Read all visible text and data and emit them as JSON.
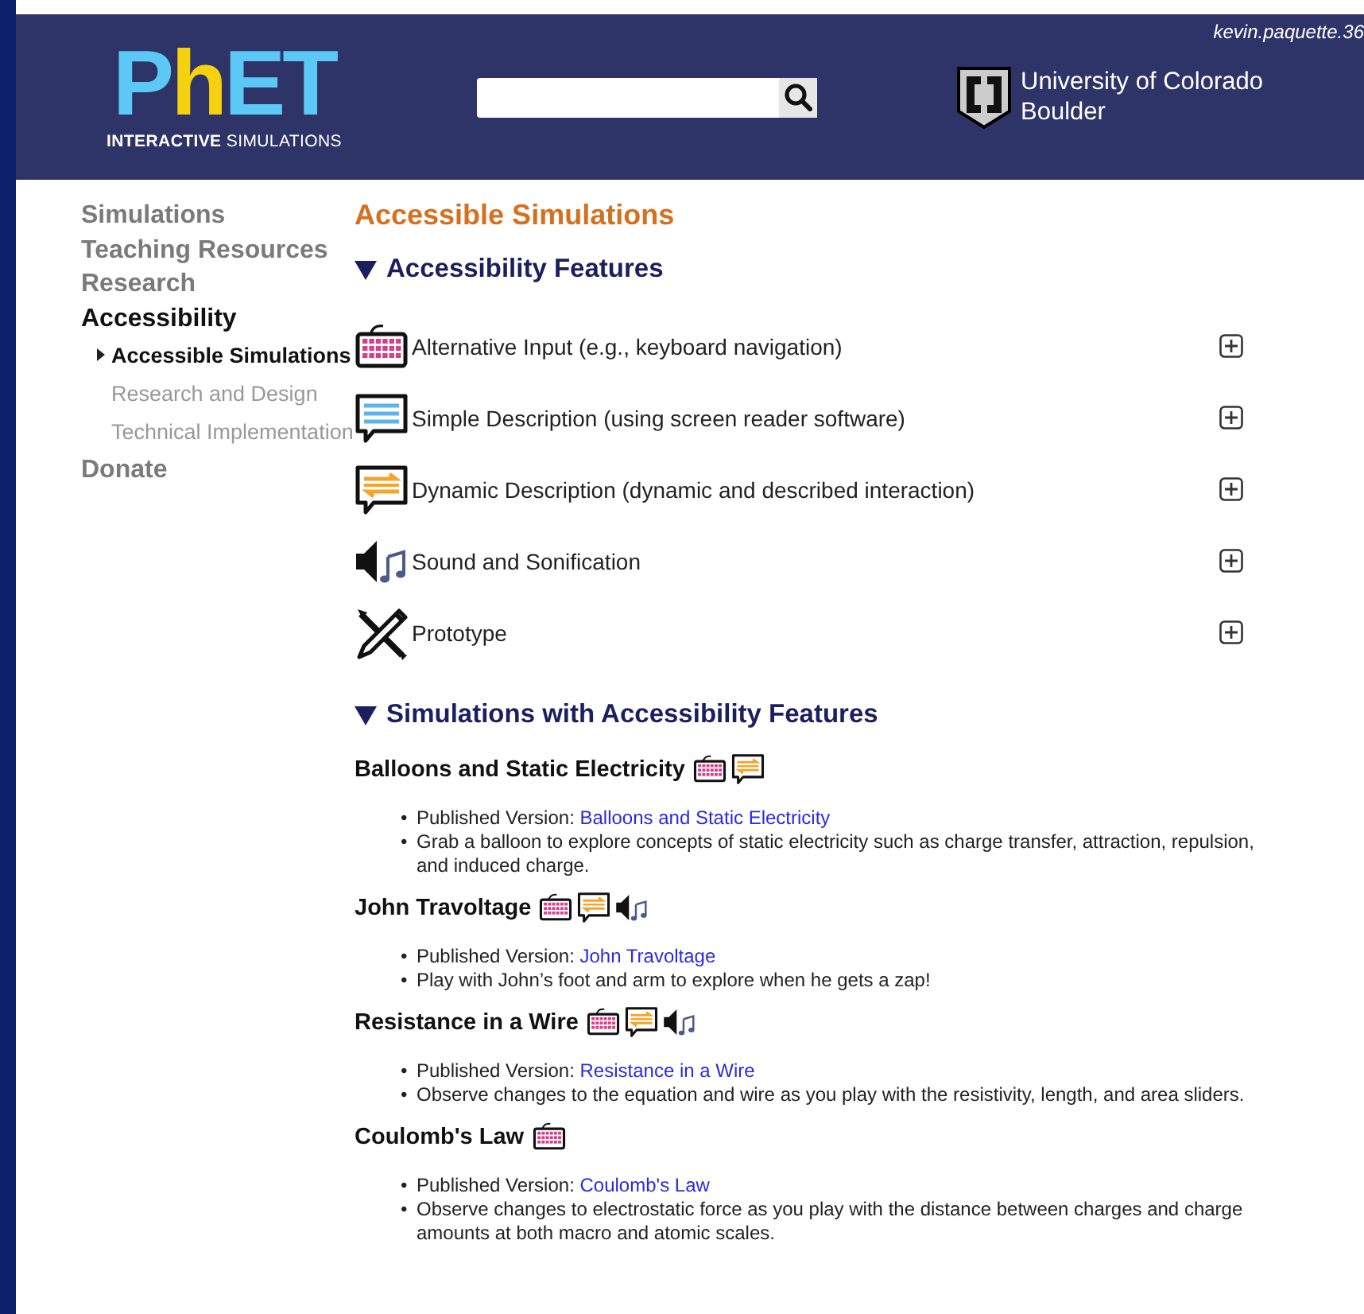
{
  "header": {
    "logo": {
      "letters": [
        {
          "text": "P",
          "accent": false
        },
        {
          "text": "h",
          "accent": true
        },
        {
          "text": "ET",
          "accent": false
        }
      ],
      "tagline": "**INTERACTIVE** SIMULATIONS"
    },
    "university": [
      "University of Colorado",
      "Boulder"
    ],
    "user": "kevin.paquette.36"
  },
  "sidebar": {
    "items": [
      {
        "label": "Simulations",
        "selected": false
      },
      {
        "label": "Teaching Resources",
        "selected": false
      },
      {
        "label": "Research",
        "selected": false
      },
      {
        "label": "Accessibility",
        "selected": true,
        "children": [
          {
            "label": "Accessible Simulations",
            "selected": true
          },
          {
            "label": "Research and Design",
            "selected": false
          },
          {
            "label": "Technical Implementation",
            "selected": false
          }
        ]
      },
      {
        "label": "Donate",
        "selected": false
      }
    ]
  },
  "page_title": "Accessible Simulations",
  "features_section": {
    "title": "Accessibility Features",
    "expanded": true,
    "items": [
      {
        "kind": "keyboard",
        "label": "Alternative Input (e.g., keyboard navigation)",
        "expanded": false
      },
      {
        "kind": "simple",
        "label": "Simple Description (using screen reader software)",
        "expanded": false
      },
      {
        "kind": "dynamic",
        "label": "Dynamic Description (dynamic and described interaction)",
        "expanded": false
      },
      {
        "kind": "sound",
        "label": "Sound and Sonification",
        "expanded": false
      },
      {
        "kind": "prototype",
        "label": "Prototype",
        "expanded": false
      }
    ]
  },
  "sims_section": {
    "title": "Simulations with Accessibility Features",
    "expanded": true,
    "items": [
      {
        "title": "Balloons and Static Electricity",
        "features": [
          {
            "kind": "keyboard"
          },
          {
            "kind": "dynamic"
          }
        ],
        "lines": [
          {
            "kind": "link",
            "marker": "•",
            "label": "Published Version:",
            "link": "Balloons and Static Electricity"
          },
          {
            "kind": "text",
            "marker": "•",
            "text": "Grab a balloon to explore concepts of static electricity such as charge transfer, attraction, repulsion, and induced charge."
          }
        ]
      },
      {
        "title": "John Travoltage",
        "features": [
          {
            "kind": "keyboard"
          },
          {
            "kind": "dynamic"
          },
          {
            "kind": "sound"
          }
        ],
        "lines": [
          {
            "kind": "link",
            "marker": "•",
            "label": "Published Version:",
            "link": "John Travoltage"
          },
          {
            "kind": "text",
            "marker": "•",
            "text": "Play with John’s foot and arm to explore when he gets a zap!"
          }
        ]
      },
      {
        "title": "Resistance in a Wire",
        "features": [
          {
            "kind": "keyboard"
          },
          {
            "kind": "dynamic"
          },
          {
            "kind": "sound"
          }
        ],
        "lines": [
          {
            "kind": "link",
            "marker": "•",
            "label": "Published Version:",
            "link": "Resistance in a Wire"
          },
          {
            "kind": "text",
            "marker": "•",
            "text": "Observe changes to the equation and wire as you play with the resistivity, length, and area sliders."
          }
        ]
      },
      {
        "title": "Coulomb's Law",
        "features": [
          {
            "kind": "keyboard"
          }
        ],
        "lines": [
          {
            "kind": "link",
            "marker": "•",
            "label": "Published Version:",
            "link": "Coulomb's Law"
          },
          {
            "kind": "text",
            "marker": "•",
            "text": "Observe changes to electrostatic force as you play with the distance between charges and charge amounts at both macro and atomic scales."
          }
        ]
      }
    ]
  }
}
